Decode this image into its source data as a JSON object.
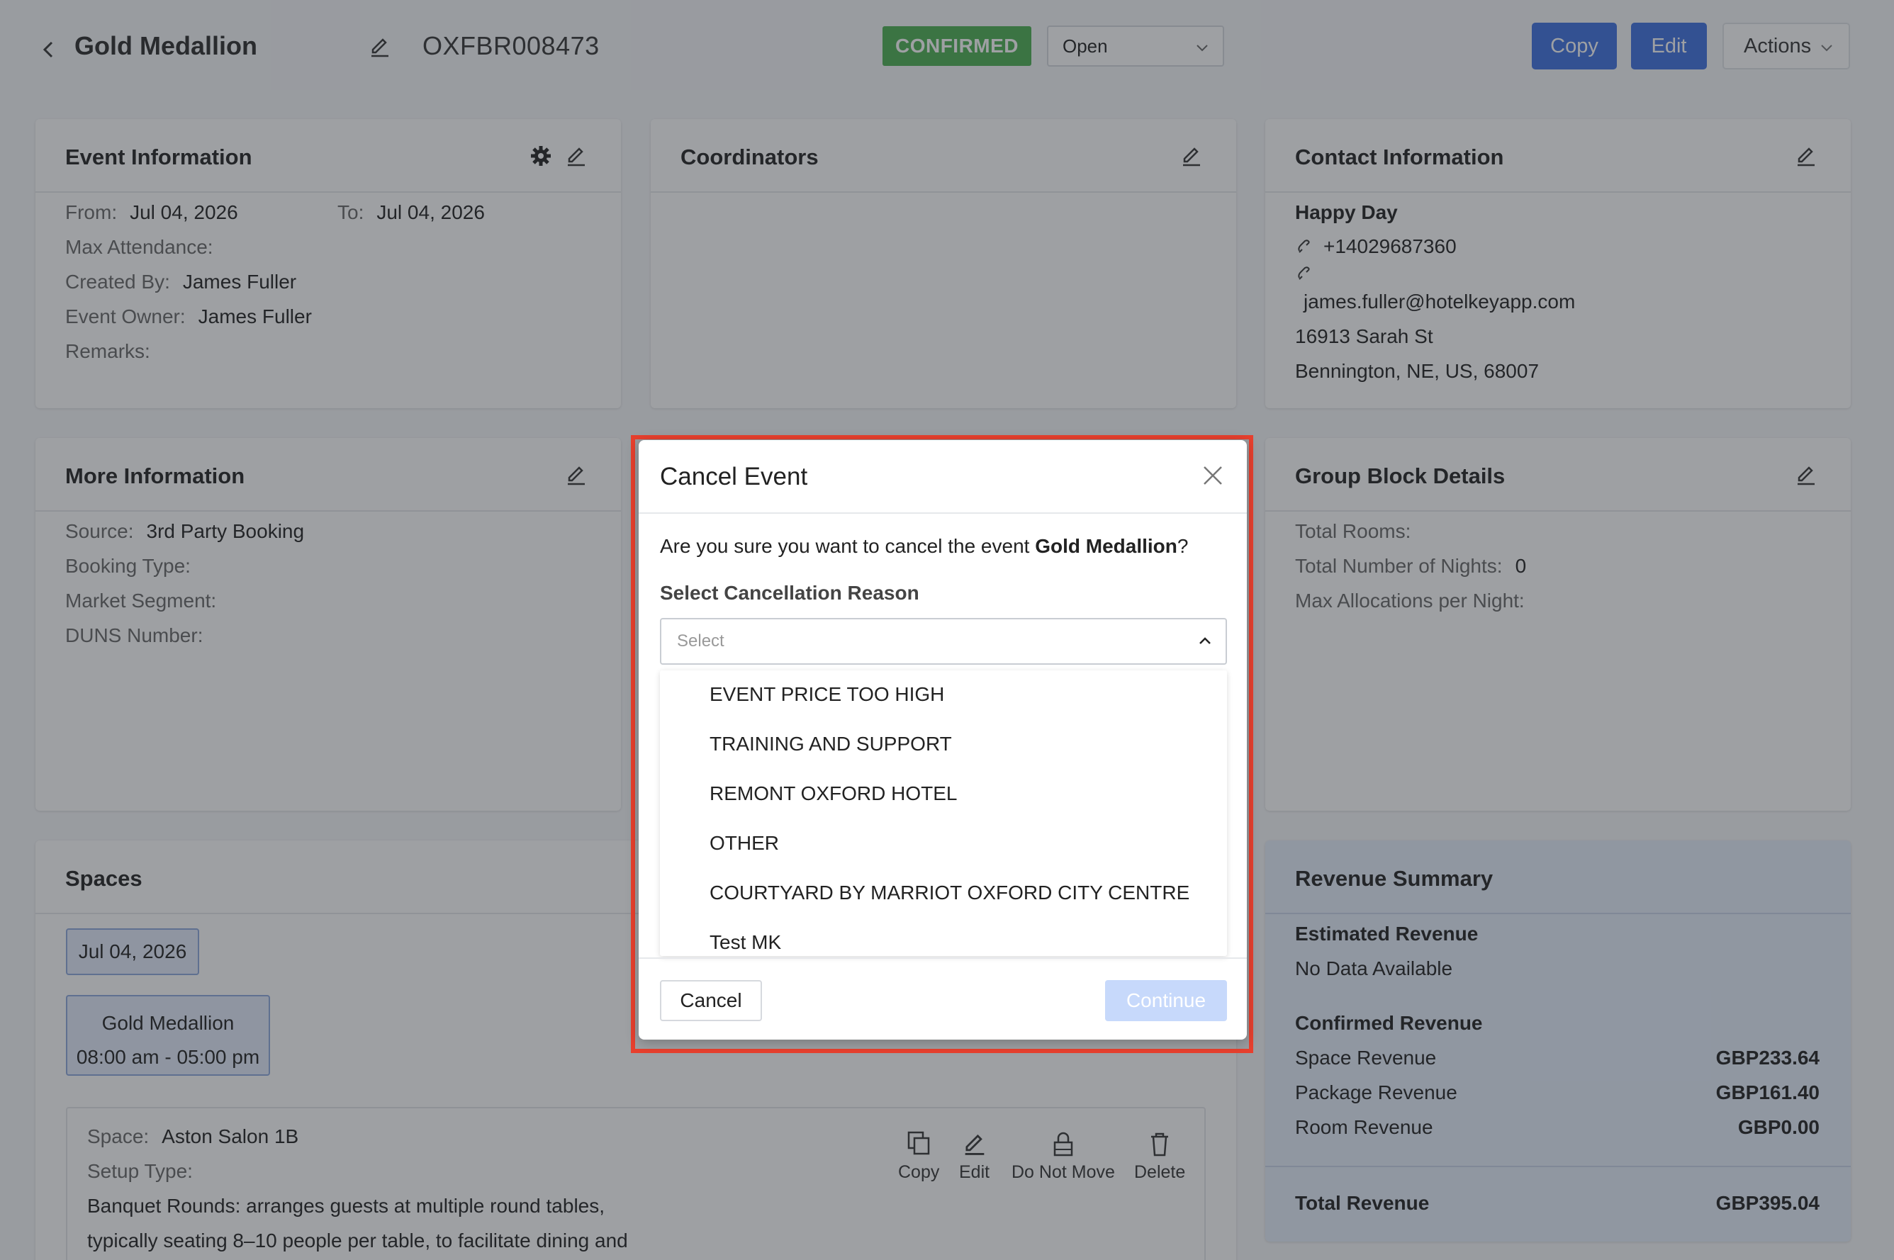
{
  "header": {
    "title": "Gold Medallion",
    "confirmation_id": "OXFBR008473",
    "status_badge": "CONFIRMED",
    "status_select_value": "Open",
    "copy_label": "Copy",
    "edit_label": "Edit",
    "actions_label": "Actions"
  },
  "event_info": {
    "title": "Event Information",
    "from_label": "From:",
    "from_value": "Jul 04, 2026",
    "to_label": "To:",
    "to_value": "Jul 04, 2026",
    "max_attendance_label": "Max Attendance:",
    "created_by_label": "Created By:",
    "created_by_value": "James Fuller",
    "owner_label": "Event Owner:",
    "owner_value": "James Fuller",
    "remarks_label": "Remarks:"
  },
  "coordinators": {
    "title": "Coordinators"
  },
  "contact": {
    "title": "Contact Information",
    "name": "Happy Day",
    "phone": "+14029687360",
    "email": "james.fuller@hotelkeyapp.com",
    "address1": "16913 Sarah St",
    "address2": "Bennington, NE, US, 68007"
  },
  "more_info": {
    "title": "More Information",
    "source_label": "Source:",
    "source_value": "3rd Party Booking",
    "booking_type_label": "Booking Type:",
    "market_segment_label": "Market Segment:",
    "duns_label": "DUNS Number:"
  },
  "group_block": {
    "title": "Group Block Details",
    "total_rooms_label": "Total Rooms:",
    "nights_label": "Total Number of Nights:",
    "nights_value": "0",
    "max_alloc_label": "Max Allocations per Night:"
  },
  "spaces": {
    "title": "Spaces",
    "date_chip": "Jul 04, 2026",
    "event_name": "Gold Medallion",
    "event_time": "08:00 am - 05:00 pm",
    "space_label": "Space:",
    "space_value": "Aston Salon 1B",
    "setup_label": "Setup Type:",
    "setup_desc_1": "Banquet Rounds: arranges guests at multiple round tables,",
    "setup_desc_2": "typically seating 8–10 people per table, to facilitate dining and",
    "tools": {
      "copy": "Copy",
      "edit": "Edit",
      "do_not_move": "Do Not Move",
      "delete": "Delete"
    }
  },
  "revenue": {
    "title": "Revenue Summary",
    "estimated_label": "Estimated Revenue",
    "no_data": "No Data Available",
    "confirmed_label": "Confirmed Revenue",
    "rows": [
      {
        "label": "Space Revenue",
        "value": "GBP233.64"
      },
      {
        "label": "Package Revenue",
        "value": "GBP161.40"
      },
      {
        "label": "Room Revenue",
        "value": "GBP0.00"
      }
    ],
    "total_label": "Total Revenue",
    "total_value": "GBP395.04"
  },
  "modal": {
    "title": "Cancel Event",
    "message_prefix": "Are you sure you want to cancel the event ",
    "message_event": "Gold Medallion",
    "message_suffix": "?",
    "reason_label": "Select Cancellation Reason",
    "select_placeholder": "Select",
    "options": [
      "EVENT PRICE TOO HIGH",
      "TRAINING AND SUPPORT",
      "REMONT OXFORD HOTEL",
      "OTHER",
      "COURTYARD BY MARRIOT OXFORD CITY CENTRE",
      "Test MK"
    ],
    "cancel_label": "Cancel",
    "continue_label": "Continue"
  },
  "colors": {
    "primary": "#3d6fe0",
    "confirmed_badge": "#4caf50",
    "highlight_border": "#e8402e",
    "continue_disabled": "#c7d9fb"
  }
}
